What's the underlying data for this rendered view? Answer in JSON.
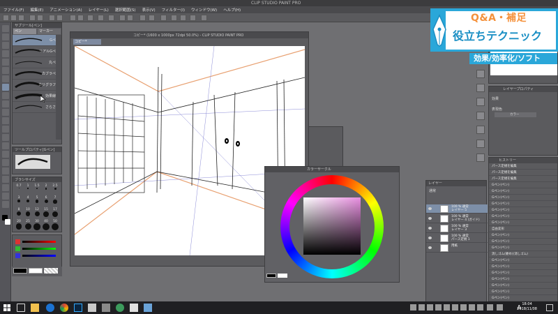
{
  "window": {
    "title": "CLIP STUDIO PAINT PRO"
  },
  "menu": [
    "ファイル(F)",
    "編集(E)",
    "アニメーション(A)",
    "レイヤー(L)",
    "選択範囲(S)",
    "表示(V)",
    "フィルター(I)",
    "ウィンドウ(W)",
    "ヘルプ(H)"
  ],
  "subtool": {
    "header": "サブツール[ペン]",
    "tabs": [
      "ペン",
      "マーカー"
    ],
    "brushes": [
      "Gペン",
      "リアルGペン",
      "丸ペン",
      "カブラペン",
      "カリグラフィ",
      "効果線用",
      "さらさら"
    ]
  },
  "toolprop": {
    "header": "ツールプロパティ[Gペン]"
  },
  "brushsize": {
    "header": "ブラシサイズ",
    "sizes": [
      "0.7",
      "1",
      "1.5",
      "2",
      "2.5",
      "3",
      "4",
      "5",
      "6",
      "7",
      "8",
      "10",
      "12",
      "15",
      "17",
      "20",
      "25",
      "30",
      "40",
      "50"
    ]
  },
  "canvas": {
    "title": "コピー* (1600 x 1000px 72dpi 50.0%) - CLIP STUDIO PAINT PRO",
    "tab": "コピー*"
  },
  "colorwheel": {
    "header": "カラーサークル"
  },
  "layers": {
    "header": "レイヤー",
    "blend": "通常",
    "items": [
      {
        "name": "100 % 通常",
        "sub": "レイヤー 5"
      },
      {
        "name": "100 % 通常",
        "sub": "レイヤー 4 (ガイド)"
      },
      {
        "name": "100 % 通常",
        "sub": "レイヤー 3"
      },
      {
        "name": "100 % 通常",
        "sub": "パース定規 1"
      },
      {
        "name": "用紙",
        "sub": ""
      }
    ]
  },
  "property": {
    "header": "レイヤープロパティ",
    "effect": "効果",
    "display_color": "表現色",
    "color_value": "カラー"
  },
  "history": {
    "header": "ヒストリー",
    "items": [
      "パース定規を編集",
      "パース定規を編集",
      "パース定規を編集",
      "Gペン(ペン)",
      "Gペン(ペン)",
      "Gペン(ペン)",
      "Gペン(ペン)",
      "Gペン(ペン)",
      "Gペン(ペン)",
      "Gペン(ペン)",
      "自由変形",
      "Gペン(ペン)",
      "Gペン(ペン)",
      "Gペン(ペン)",
      "消しゴム(硬め)(消しゴム)",
      "Gペン(ペン)",
      "Gペン(ペン)",
      "Gペン(ペン)",
      "Gペン(ペン)",
      "Gペン(ペン)",
      "Gペン(ペン)",
      "Gペン(ペン)",
      "自由変形"
    ]
  },
  "banner": {
    "line1": "Q&A・補足",
    "line2": "役立ちテクニック",
    "line3": "効果/効率化/ソフト"
  },
  "taskbar": {
    "time": "18:04",
    "date": "2018/11/08",
    "ime": "A"
  },
  "colors": {
    "accent": "#2aa7d9",
    "orange": "#f5913b",
    "selection": "#7d8fa8"
  }
}
